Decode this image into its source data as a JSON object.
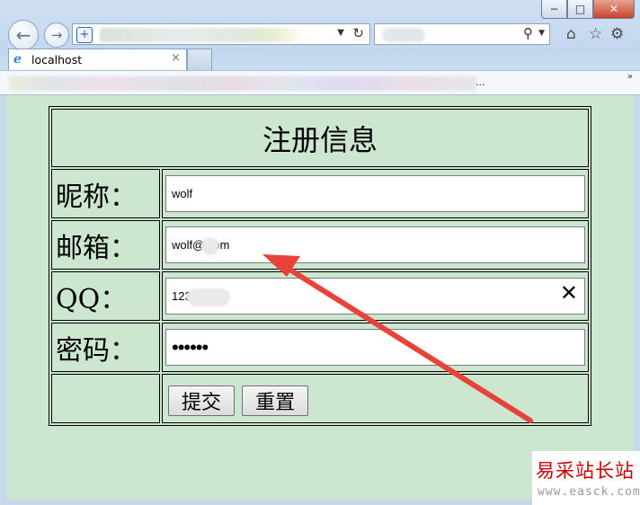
{
  "browser": {
    "tab_title": "localhost",
    "tab_close": "×",
    "fav_ellipsis": "...",
    "fav_more": "»",
    "buttons": {
      "minimize": "−",
      "maximize": "□",
      "close": "✕"
    }
  },
  "form": {
    "title": "注册信息",
    "fields": [
      {
        "label": "昵称：",
        "value": "wolf"
      },
      {
        "label": "邮箱：",
        "value": "wolf@ com"
      },
      {
        "label": "QQ：",
        "value": "123 0",
        "clear": "✕"
      },
      {
        "label": "密码：",
        "value": "••••••"
      }
    ],
    "submit_label": "提交",
    "reset_label": "重置"
  },
  "annotation": {
    "arrow_color": "#e8423a"
  },
  "watermark": {
    "text": "易采站长站",
    "url": "www.easck.com"
  }
}
